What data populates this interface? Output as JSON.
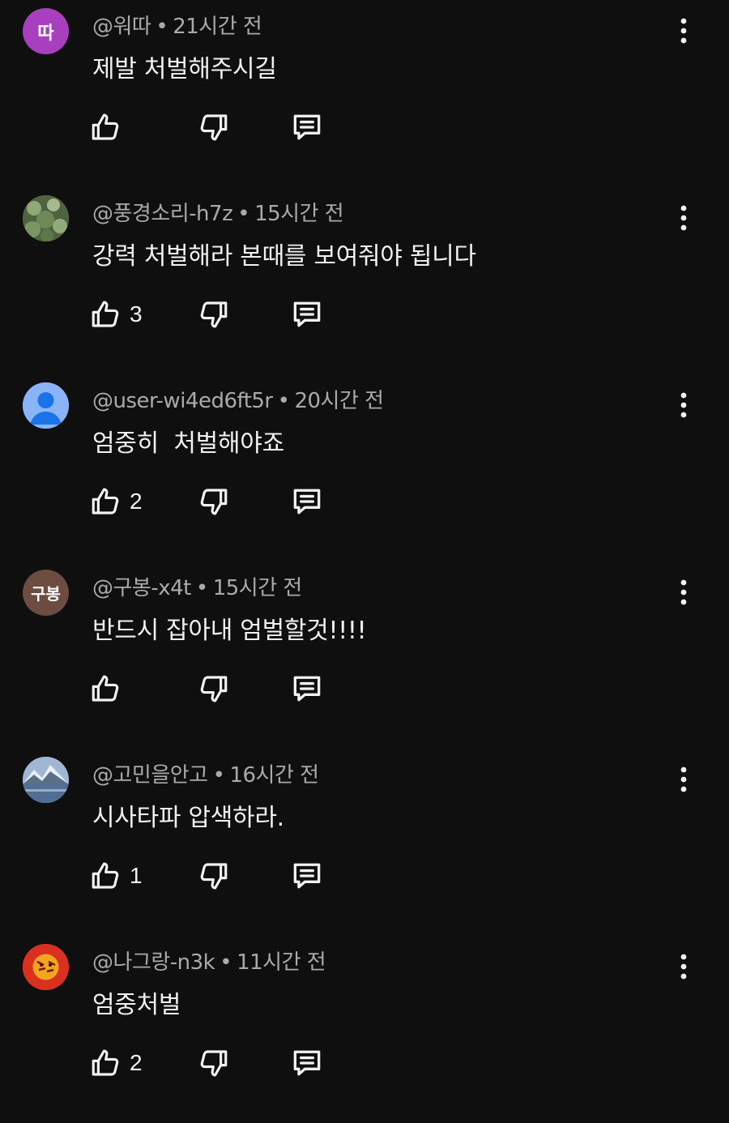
{
  "comments": [
    {
      "avatar_text": "따",
      "avatar_color": "#a73fbf",
      "avatar_type": "letter",
      "handle": "@워따",
      "time": "21시간 전",
      "text": "제발 처벌해주시길",
      "likes": ""
    },
    {
      "avatar_text": "",
      "avatar_color": "#6b7f55",
      "avatar_type": "photo-plants",
      "handle": "@풍경소리-h7z",
      "time": "15시간 전",
      "text": "강력 처벌해라 본때를 보여줘야 됩니다",
      "likes": "3"
    },
    {
      "avatar_text": "",
      "avatar_color": "#8ab4f8",
      "avatar_type": "default-person",
      "handle": "@user-wi4ed6ft5r",
      "time": "20시간 전",
      "text": "엄중히  처벌해야죠",
      "likes": "2"
    },
    {
      "avatar_text": "구봉",
      "avatar_color": "#6d4c41",
      "avatar_type": "letter",
      "handle": "@구봉-x4t",
      "time": "15시간 전",
      "text": "반드시 잡아내 엄벌할것!!!!",
      "likes": ""
    },
    {
      "avatar_text": "",
      "avatar_color": "#7c93b8",
      "avatar_type": "photo-mountain",
      "handle": "@고민을안고",
      "time": "16시간 전",
      "text": "시사타파 압색하라.",
      "likes": "1"
    },
    {
      "avatar_text": "",
      "avatar_color": "#e2402b",
      "avatar_type": "photo-tiger",
      "handle": "@나그랑-n3k",
      "time": "11시간 전",
      "text": "엄중처벌",
      "likes": "2"
    }
  ],
  "icons": {
    "like": "thumbs-up-icon",
    "dislike": "thumbs-down-icon",
    "reply": "reply-comment-icon",
    "more": "more-vertical-icon"
  },
  "separator": "•"
}
